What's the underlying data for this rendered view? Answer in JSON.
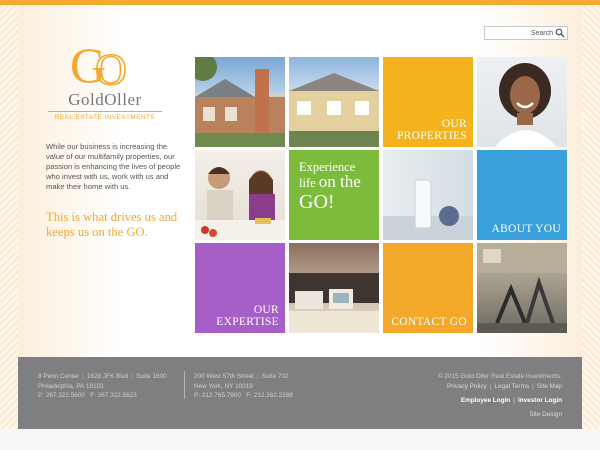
{
  "search": {
    "placeholder": "Search"
  },
  "logo": {
    "mark": "GO",
    "name": "GoldOller",
    "subtitle": "REAL ESTATE INVESTMENTS"
  },
  "intro": {
    "text": "While our business is increasing the value of our multifamily properties, our passion is enhancing the lives of people who invest with us, work with us and make their home with us.",
    "tagline": "This is what drives us and keeps us on the GO."
  },
  "tiles": {
    "properties": {
      "line1": "OUR",
      "line2": "PROPERTIES"
    },
    "experience": {
      "line1": "Experience",
      "line2a": "life",
      "line2b": "on the",
      "line3": "GO!"
    },
    "about": {
      "label": "ABOUT YOU"
    },
    "expertise": {
      "line1": "OUR",
      "line2": "EXPERTISE"
    },
    "contact": {
      "label": "CONTACT GO"
    }
  },
  "colors": {
    "accent": "#f4a830",
    "properties_tile": "#f4b21c",
    "experience_tile": "#7dbb3c",
    "about_tile": "#3aa0dc",
    "expertise_tile": "#a55fc6",
    "contact_tile": "#f4a82a",
    "footer_bg": "#7f7f81"
  },
  "footer": {
    "address1": {
      "line1_a": "8 Penn Center",
      "line1_b": "1628 JFK Blvd",
      "line1_c": "Suite 1600",
      "line2": "Philadelphia, PA 19103",
      "phone": "P: 267.322.5600",
      "fax": "F: 267.322.5623"
    },
    "address2": {
      "line1_a": "200 West 57th Street",
      "line1_b": "Suite 702",
      "line2": "New York, NY 10019",
      "phone": "P: 212.765.7900",
      "fax": "F: 212.262.2288"
    },
    "copyright": "© 2015 Gold Oller Real Estate Investments.",
    "links": {
      "privacy": "Privacy Policy",
      "legal": "Legal Terms",
      "sitemap": "Site Map"
    },
    "logins": {
      "employee": "Employee Login",
      "investor": "Investor Login"
    },
    "site_design": "Site Design"
  }
}
